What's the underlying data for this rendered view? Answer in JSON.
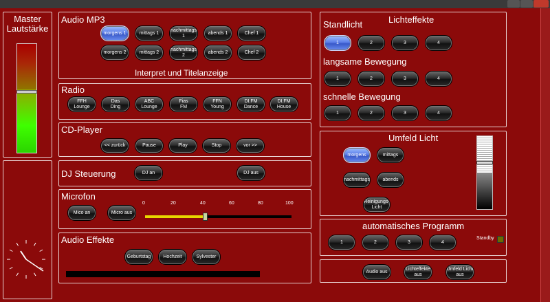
{
  "master": {
    "title": "Master\nLautstärke",
    "level_percent": 62
  },
  "audio": {
    "title": "Audio MP3",
    "row1": [
      "morgens 1",
      "mittags 1",
      "nachmittags\n1",
      "abends 1",
      "Chef 1"
    ],
    "row2": [
      "morgens 2",
      "mittags 2",
      "nachmittags\n2",
      "abends 2",
      "Chef 2"
    ],
    "display": "Interpret und Titelanzeige"
  },
  "radio": {
    "title": "Radio",
    "buttons": [
      "FFH\nLounge",
      "Das\nDing",
      "ABC\nLounge",
      "Fias\nFM",
      "FFN\nYoung",
      "DI.FM\nDance",
      "DI.FM\nHouse"
    ]
  },
  "cd": {
    "title": "CD-Player",
    "buttons": [
      "<< zurück",
      "Pause",
      "Play",
      "Stop",
      "vor >>"
    ]
  },
  "dj": {
    "title": "DJ Steuerung",
    "on": "DJ an",
    "off": "DJ aus"
  },
  "micro": {
    "title": "Microfon",
    "on": "Mico an",
    "off": "Micro aus",
    "ticks": [
      "0",
      "20",
      "40",
      "60",
      "80",
      "100"
    ],
    "value": 41
  },
  "effects": {
    "title": "Audio Effekte",
    "buttons": [
      "Geburtstag",
      "Hochzeit",
      "Sylvester"
    ]
  },
  "licht": {
    "title": "Lichteffekte",
    "standlicht": "Standlicht",
    "langsam": "langsame Bewegung",
    "schnell": "schnelle Bewegung",
    "nums": [
      "1",
      "2",
      "3",
      "4"
    ]
  },
  "umfeld": {
    "title": "Umfeld Licht",
    "buttons": [
      "morgens",
      "mittags",
      "nachmittags",
      "abends",
      "Reinigungs-\nLicht"
    ],
    "level_percent": 64
  },
  "auto": {
    "title": "automatisches Programm",
    "nums": [
      "1",
      "2",
      "3",
      "4"
    ],
    "standby": "Standby"
  },
  "bottom": {
    "buttons": [
      "Audio aus",
      "Lichteffekte\naus",
      "Umfeld Licht\naus"
    ]
  },
  "colors": {
    "background": "#8b0a0a",
    "selected": "#5c7ee8",
    "slider_fill": "#e8d800"
  }
}
